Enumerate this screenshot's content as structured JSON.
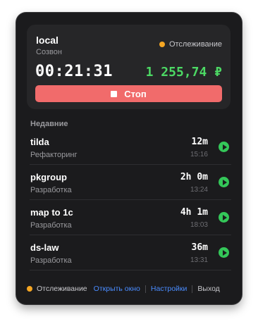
{
  "current": {
    "project": "local",
    "task": "Созвон",
    "status_label": "Отслеживание",
    "timer": "00:21:31",
    "earnings": "1 255,74 ₽",
    "stop_label": "Стоп"
  },
  "recent": {
    "heading": "Недавние",
    "items": [
      {
        "name": "tilda",
        "task": "Рефакторинг",
        "duration": "12m",
        "time": "15:16"
      },
      {
        "name": "pkgroup",
        "task": "Разработка",
        "duration": "2h 0m",
        "time": "13:24"
      },
      {
        "name": "map to 1c",
        "task": "Разработка",
        "duration": "4h 1m",
        "time": "18:03"
      },
      {
        "name": "ds-law",
        "task": "Разработка",
        "duration": "36m",
        "time": "13:31"
      }
    ]
  },
  "footer": {
    "status_label": "Отслеживание",
    "open_window": "Открыть окно",
    "settings": "Настройки",
    "exit": "Выход"
  },
  "colors": {
    "panel_bg": "#1b1b1d",
    "card_bg": "#262628",
    "stop_button": "#f16b6b",
    "earnings_green": "#4cd964",
    "play_green": "#34c759",
    "status_dot": "#f5a623",
    "link_blue": "#4a8cff"
  },
  "icons": {
    "status": "orange-dot-icon",
    "stop": "stop-square-icon",
    "play": "play-icon"
  }
}
